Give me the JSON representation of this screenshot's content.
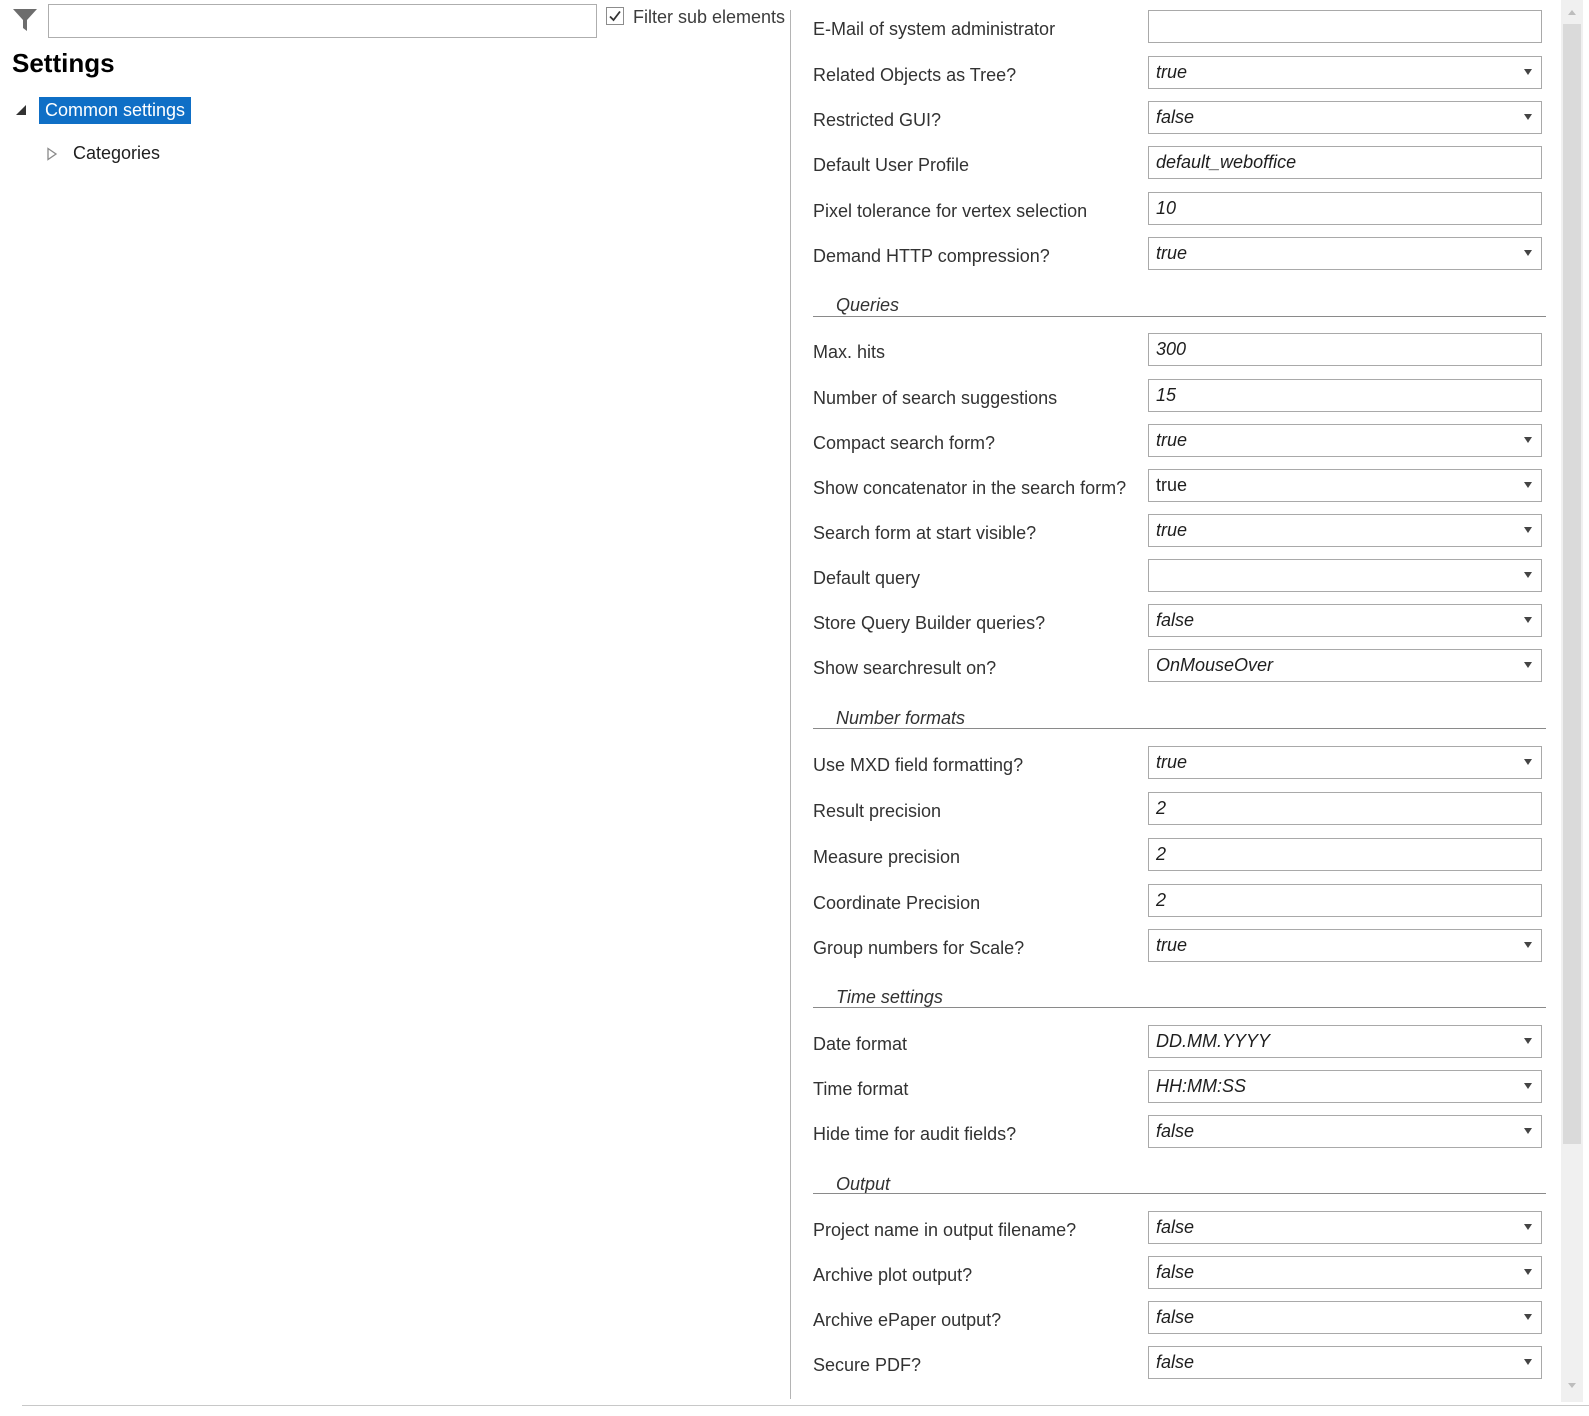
{
  "filter": {
    "placeholder": "",
    "checkbox_label": "Filter sub elements",
    "checkbox_checked": true
  },
  "page_title": "Settings",
  "tree": {
    "selected_label": "Common settings",
    "child_label": "Categories"
  },
  "colors": {
    "selection": "#0f6fc6",
    "divider": "#b4b4b4",
    "field_border": "#a9a9a9"
  },
  "icons": {
    "filter": "funnel-icon",
    "expanded": "triangle-down-right-icon",
    "collapsed": "triangle-right-outline-icon",
    "dropdown": "chevron-down-icon"
  },
  "properties": {
    "admin_email": {
      "label": "E-Mail of system administrator",
      "value": ""
    },
    "related_objects_tree": {
      "label": "Related Objects as Tree?",
      "value": "true"
    },
    "restricted_gui": {
      "label": "Restricted GUI?",
      "value": "false"
    },
    "default_user_profile": {
      "label": "Default User Profile",
      "value": "default_weboffice"
    },
    "pixel_tolerance": {
      "label": "Pixel tolerance for vertex selection",
      "value": "10"
    },
    "http_compression": {
      "label": "Demand HTTP compression?",
      "value": "true"
    }
  },
  "queries": {
    "title": "Queries",
    "max_hits": {
      "label": "Max. hits",
      "value": "300"
    },
    "search_suggestions": {
      "label": "Number of search suggestions",
      "value": "15"
    },
    "compact_search": {
      "label": "Compact search form?",
      "value": "true"
    },
    "show_concatenator": {
      "label": "Show concatenator in the search form?",
      "value": "true"
    },
    "search_start_visible": {
      "label": "Search form at start visible?",
      "value": "true"
    },
    "default_query": {
      "label": "Default query",
      "value": ""
    },
    "store_qb_queries": {
      "label": "Store Query Builder queries?",
      "value": "false"
    },
    "show_searchresult": {
      "label": "Show searchresult on?",
      "value": "OnMouseOver"
    }
  },
  "number_formats": {
    "title": "Number formats",
    "mxd_formatting": {
      "label": "Use MXD field formatting?",
      "value": "true"
    },
    "result_precision": {
      "label": "Result precision",
      "value": "2"
    },
    "measure_precision": {
      "label": "Measure precision",
      "value": "2"
    },
    "coordinate_precision": {
      "label": "Coordinate Precision",
      "value": "2"
    },
    "group_numbers": {
      "label": "Group numbers for Scale?",
      "value": "true"
    }
  },
  "time_settings": {
    "title": "Time settings",
    "date_format": {
      "label": "Date format",
      "value": "DD.MM.YYYY"
    },
    "time_format": {
      "label": "Time format",
      "value": "HH:MM:SS"
    },
    "hide_audit_time": {
      "label": "Hide time for audit fields?",
      "value": "false"
    }
  },
  "output": {
    "title": "Output",
    "project_in_filename": {
      "label": "Project name in output filename?",
      "value": "false"
    },
    "archive_plot": {
      "label": "Archive plot output?",
      "value": "false"
    },
    "archive_epaper": {
      "label": "Archive ePaper output?",
      "value": "false"
    },
    "secure_pdf": {
      "label": "Secure PDF?",
      "value": "false"
    }
  }
}
